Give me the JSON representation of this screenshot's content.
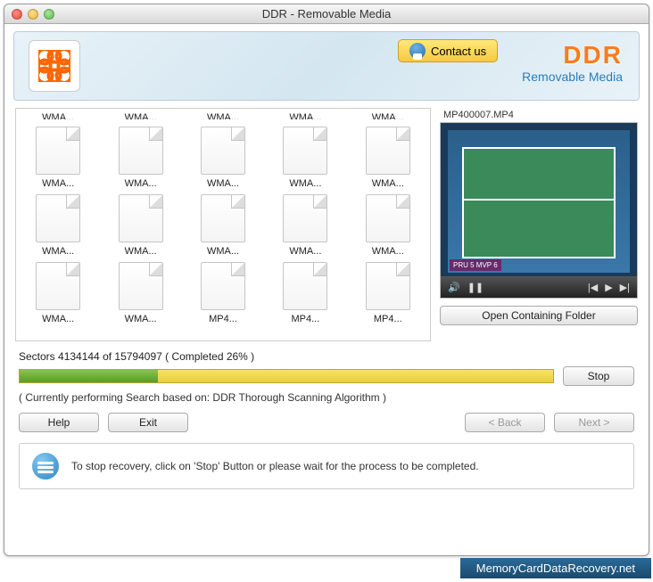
{
  "window": {
    "title": "DDR - Removable Media"
  },
  "header": {
    "contact_label": "Contact us",
    "brand_title": "DDR",
    "brand_subtitle": "Removable Media"
  },
  "files": {
    "top_cut": [
      "WMA...",
      "WMA...",
      "WMA...",
      "WMA...",
      "WMA..."
    ],
    "rows": [
      [
        "WMA...",
        "WMA...",
        "WMA...",
        "WMA...",
        "WMA..."
      ],
      [
        "WMA...",
        "WMA...",
        "WMA...",
        "WMA...",
        "WMA..."
      ],
      [
        "WMA...",
        "WMA...",
        "MP4...",
        "MP4...",
        "MP4..."
      ]
    ]
  },
  "preview": {
    "filename": "MP400007.MP4",
    "score": "PRU 5   MVP 6",
    "open_folder": "Open Containing Folder"
  },
  "progress": {
    "sectors_text": "Sectors 4134144 of 15794097   ( Completed 26% )",
    "percent": 26,
    "stop_label": "Stop",
    "algo_text": "( Currently performing Search based on: DDR Thorough Scanning Algorithm )"
  },
  "nav": {
    "help": "Help",
    "exit": "Exit",
    "back": "< Back",
    "next": "Next >"
  },
  "hint": {
    "text": "To stop recovery, click on 'Stop' Button or please wait for the process to be completed."
  },
  "footer": {
    "site": "MemoryCardDataRecovery.net"
  }
}
